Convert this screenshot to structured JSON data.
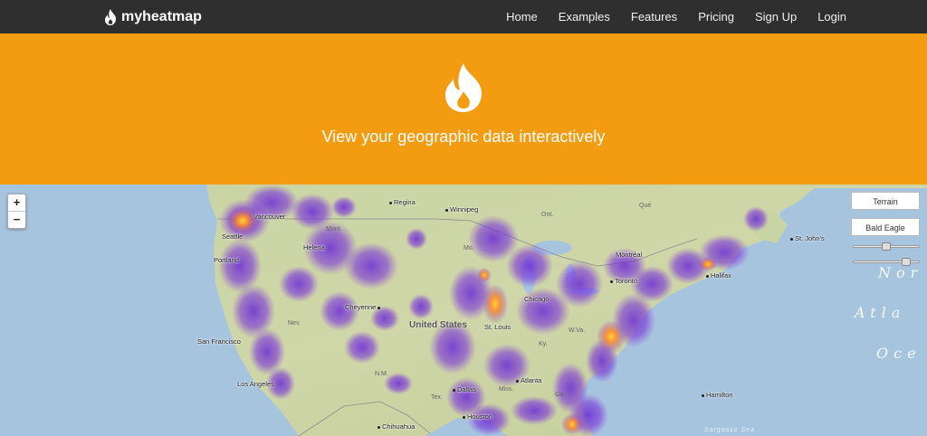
{
  "brand": {
    "name": "myheatmap",
    "icon": "flame-icon"
  },
  "nav": {
    "items": [
      "Home",
      "Examples",
      "Features",
      "Pricing",
      "Sign Up",
      "Login"
    ]
  },
  "hero": {
    "icon": "flame-icon",
    "tagline": "View your geographic data interactively",
    "bg_color": "#f39c12"
  },
  "map": {
    "zoom_in": "+",
    "zoom_out": "−",
    "layer_button": "Terrain",
    "dataset_button": "Bald Eagle",
    "country_label": "United States",
    "cities": [
      "Regina",
      "Winnipeg",
      "Vancouver",
      "Seattle",
      "Helena",
      "Portland",
      "Cheyenne",
      "San Francisco",
      "Los Angeles",
      "Dallas",
      "Houston",
      "Chihuahua",
      "Chicago",
      "St. Louis",
      "Toronto",
      "Montréal",
      "Halifax",
      "St. John's",
      "Atlanta",
      "Hamilton"
    ],
    "regions": [
      "Ont.",
      "Qué",
      "Nev.",
      "N.M.",
      "Tex.",
      "Miss.",
      "Ky.",
      "W.Va.",
      "Mo.",
      "Ga.",
      "Mont."
    ],
    "ocean_lines": [
      "Nor",
      "Atla",
      "Oce"
    ],
    "sea_label": "Sargasso Sea"
  }
}
